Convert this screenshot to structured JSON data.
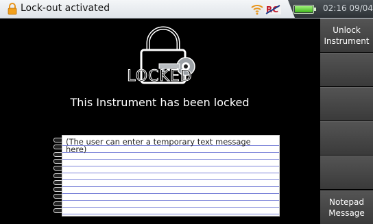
{
  "status_bar": {
    "title": "Lock-out activated",
    "time": "02:16",
    "date": "09/04/2015",
    "icons": [
      "lock-icon",
      "wifi-icon",
      "remote-control-icon",
      "battery-icon"
    ],
    "battery_level": 1.0
  },
  "main": {
    "locked_label": "LOCKED",
    "message": "This Instrument has been locked",
    "notepad_text": "(The user can enter a temporary text message here)"
  },
  "softkeys": [
    {
      "label": "Unlock\nInstrument"
    },
    {
      "label": ""
    },
    {
      "label": ""
    },
    {
      "label": ""
    },
    {
      "label": ""
    },
    {
      "label": "Notepad\nMessage"
    }
  ],
  "colors": {
    "accent_battery": "#41b81b",
    "notepad_lines": "#7a82d8",
    "lock_icon": "#f2a01b"
  }
}
